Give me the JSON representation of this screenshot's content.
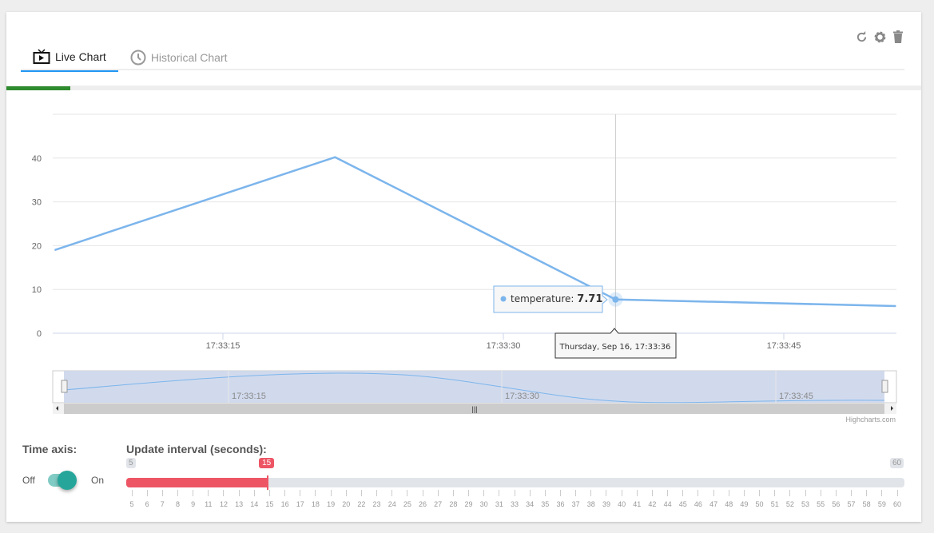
{
  "tabs": [
    {
      "label": "Live Chart",
      "icon": "tv-play-icon",
      "active": true
    },
    {
      "label": "Historical Chart",
      "icon": "clock-icon",
      "active": false
    }
  ],
  "toolbar": {
    "icons": [
      "refresh-icon",
      "gear-icon",
      "trash-icon"
    ]
  },
  "progress": 0.07,
  "chart_data": {
    "type": "line",
    "series": [
      {
        "name": "temperature",
        "x": [
          "17:33:06",
          "17:33:21",
          "17:33:36",
          "17:33:51"
        ],
        "values": [
          19,
          40.2,
          7.71,
          6.2
        ],
        "color": "#7cb5ec"
      }
    ],
    "ylim": [
      0,
      50
    ],
    "yticks": [
      0,
      10,
      20,
      30,
      40
    ],
    "xticks": [
      "17:33:15",
      "17:33:30",
      "17:33:45"
    ],
    "grid": true,
    "tooltip": {
      "series": "temperature",
      "value": "7.71",
      "header": "Thursday, Sep 16, 17:33:36"
    },
    "navigator_ticks": [
      "17:33:15",
      "17:33:30",
      "17:33:45"
    ],
    "credits": "Highcharts.com"
  },
  "controls": {
    "time_axis_label": "Time axis:",
    "off": "Off",
    "on": "On",
    "time_axis_on": true,
    "interval_label": "Update interval (seconds):",
    "min": "5",
    "max": "60",
    "value": "15",
    "accent": "#ed5565",
    "ticks": [
      "5",
      "6",
      "7",
      "8",
      "9",
      "11",
      "12",
      "13",
      "14",
      "15",
      "16",
      "17",
      "18",
      "19",
      "20",
      "22",
      "23",
      "24",
      "25",
      "26",
      "27",
      "28",
      "29",
      "30",
      "31",
      "33",
      "34",
      "35",
      "36",
      "37",
      "38",
      "39",
      "40",
      "41",
      "42",
      "44",
      "45",
      "46",
      "47",
      "48",
      "49",
      "50",
      "51",
      "52",
      "53",
      "55",
      "56",
      "57",
      "58",
      "59",
      "60"
    ]
  }
}
